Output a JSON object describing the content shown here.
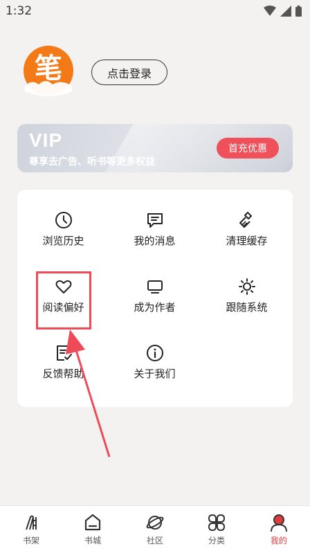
{
  "status_bar": {
    "time": "1:32"
  },
  "profile": {
    "avatar_char": "笔",
    "login_label": "点击登录"
  },
  "vip": {
    "title": "VIP",
    "subtitle": "尊享去广告、听书等更多权益",
    "button_label": "首充优惠"
  },
  "menu": {
    "items": [
      {
        "label": "浏览历史",
        "icon": "clock-icon"
      },
      {
        "label": "我的消息",
        "icon": "message-icon"
      },
      {
        "label": "清理缓存",
        "icon": "broom-icon"
      },
      {
        "label": "阅读偏好",
        "icon": "heart-icon"
      },
      {
        "label": "成为作者",
        "icon": "monitor-icon"
      },
      {
        "label": "跟随系统",
        "icon": "sun-icon"
      },
      {
        "label": "反馈帮助",
        "icon": "feedback-icon"
      },
      {
        "label": "关于我们",
        "icon": "info-icon"
      }
    ]
  },
  "tabs": [
    {
      "label": "书架",
      "icon": "bookshelf-icon"
    },
    {
      "label": "书城",
      "icon": "bookstore-icon"
    },
    {
      "label": "社区",
      "icon": "planet-icon"
    },
    {
      "label": "分类",
      "icon": "category-icon"
    },
    {
      "label": "我的",
      "icon": "user-icon",
      "active": true
    }
  ],
  "colors": {
    "accent": "#e23d3d",
    "avatar_orange": "#f47a17",
    "vip_button": "#f0505a",
    "annotation": "#ef4a58"
  }
}
